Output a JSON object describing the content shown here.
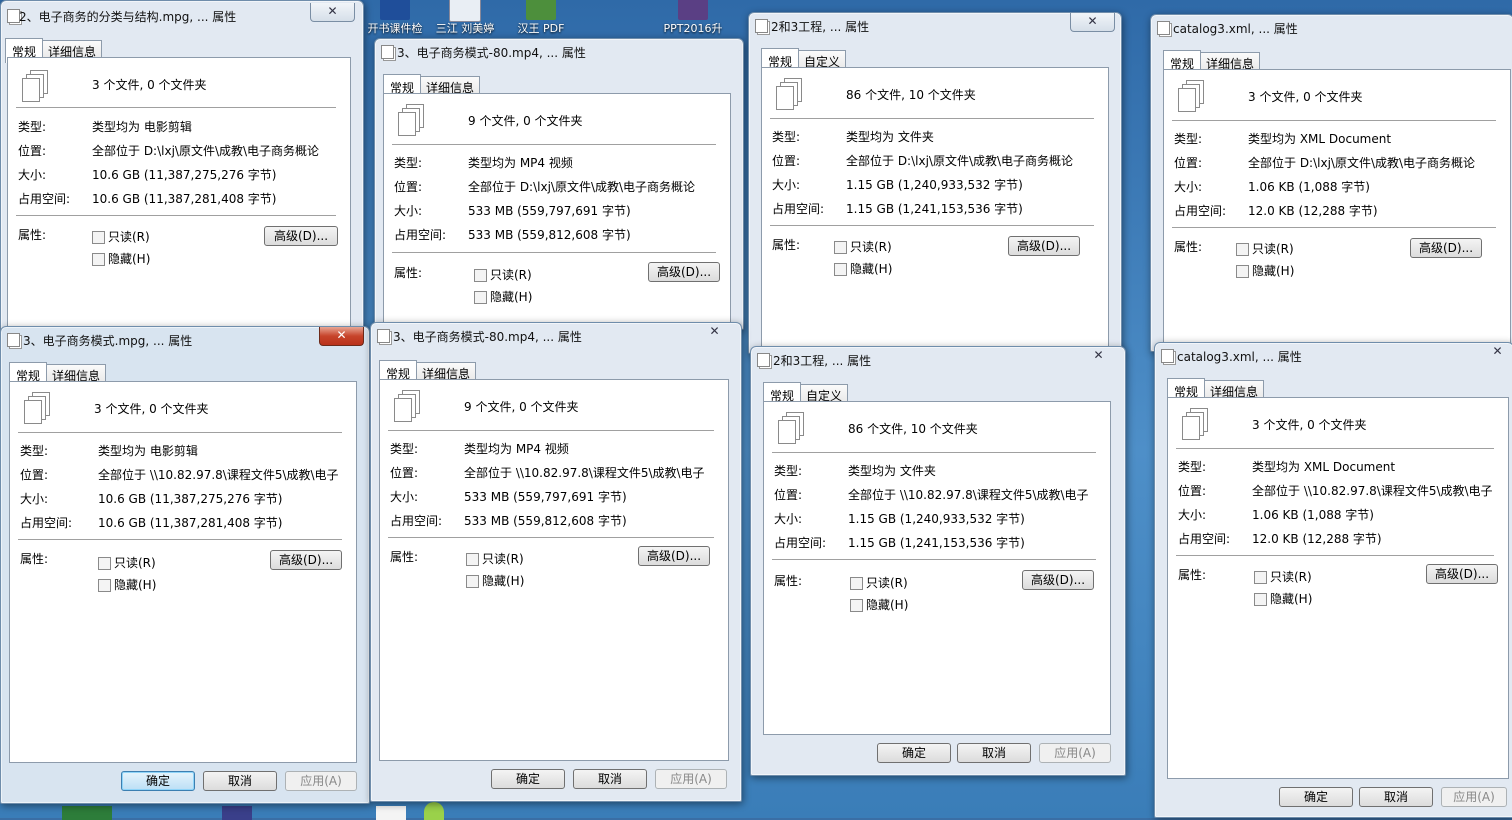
{
  "desktop": {
    "icons": [
      {
        "label": "开书课件检",
        "color": "#1f4e9a"
      },
      {
        "label": "三江 刘美婷",
        "color": "#e9eef4"
      },
      {
        "label": "汉王 PDF",
        "color": "#4d8f3c"
      },
      {
        "label": "PPT2016升",
        "color": "#5a3f84"
      }
    ]
  },
  "labels": {
    "tab_general": "常规",
    "tab_details": "详细信息",
    "tab_custom": "自定义",
    "type": "类型:",
    "location": "位置:",
    "size": "大小:",
    "size_on_disk": "占用空间:",
    "attributes": "属性:",
    "readonly": "只读(R)",
    "hidden": "隐藏(H)",
    "advanced": "高级(D)...",
    "ok": "确定",
    "cancel": "取消",
    "apply": "应用(A)"
  },
  "windows": [
    {
      "title": "2、电子商务的分类与结构.mpg, ... 属性",
      "summary": "3 个文件, 0 个文件夹",
      "type": "类型均为 电影剪辑",
      "location": "全部位于 D:\\lxj\\原文件\\成教\\电子商务概论",
      "size": "10.6 GB (11,387,275,276 字节)",
      "size_on_disk": "10.6 GB (11,387,281,408 字节)"
    },
    {
      "title": "3、电子商务模式-80.mp4, ... 属性",
      "summary": "9 个文件, 0 个文件夹",
      "type": "类型均为 MP4 视频",
      "location": "全部位于 D:\\lxj\\原文件\\成教\\电子商务概论",
      "size": "533 MB (559,797,691 字节)",
      "size_on_disk": "533 MB (559,812,608 字节)"
    },
    {
      "title": "2和3工程, ... 属性",
      "summary": "86 个文件, 10 个文件夹",
      "type": "类型均为 文件夹",
      "location": "全部位于 D:\\lxj\\原文件\\成教\\电子商务概论",
      "size": "1.15 GB (1,240,933,532 字节)",
      "size_on_disk": "1.15 GB (1,241,153,536 字节)"
    },
    {
      "title": "catalog3.xml, ... 属性",
      "summary": "3 个文件, 0 个文件夹",
      "type": "类型均为 XML Document",
      "location": "全部位于 D:\\lxj\\原文件\\成教\\电子商务概论",
      "size": "1.06 KB (1,088 字节)",
      "size_on_disk": "12.0 KB (12,288 字节)"
    },
    {
      "title": "3、电子商务模式.mpg, ... 属性",
      "summary": "3 个文件, 0 个文件夹",
      "type": "类型均为 电影剪辑",
      "location": "全部位于 \\\\10.82.97.8\\课程文件5\\成教\\电子",
      "size": "10.6 GB (11,387,275,276 字节)",
      "size_on_disk": "10.6 GB (11,387,281,408 字节)"
    },
    {
      "title": "3、电子商务模式-80.mp4, ... 属性",
      "summary": "9 个文件, 0 个文件夹",
      "type": "类型均为 MP4 视频",
      "location": "全部位于 \\\\10.82.97.8\\课程文件5\\成教\\电子",
      "size": "533 MB (559,797,691 字节)",
      "size_on_disk": "533 MB (559,812,608 字节)"
    },
    {
      "title": "2和3工程, ... 属性",
      "summary": "86 个文件, 10 个文件夹",
      "type": "类型均为 文件夹",
      "location": "全部位于 \\\\10.82.97.8\\课程文件5\\成教\\电子",
      "size": "1.15 GB (1,240,933,532 字节)",
      "size_on_disk": "1.15 GB (1,241,153,536 字节)"
    },
    {
      "title": "catalog3.xml, ... 属性",
      "summary": "3 个文件, 0 个文件夹",
      "type": "类型均为 XML Document",
      "location": "全部位于 \\\\10.82.97.8\\课程文件5\\成教\\电子",
      "size": "1.06 KB (1,088 字节)",
      "size_on_disk": "12.0 KB (12,288 字节)"
    }
  ]
}
